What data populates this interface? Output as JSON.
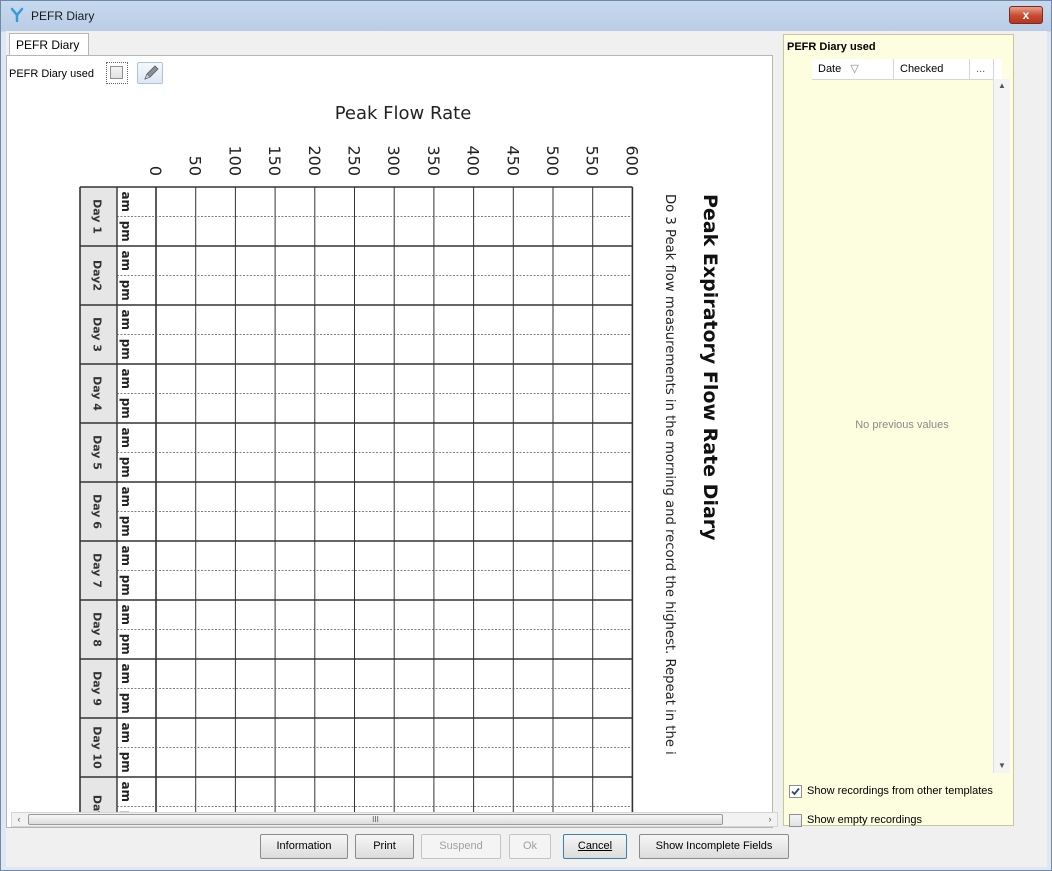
{
  "window": {
    "title": "PEFR Diary",
    "close_label": "x"
  },
  "tabs": [
    {
      "label": "PEFR Diary"
    }
  ],
  "form": {
    "used_label": "PEFR Diary used",
    "used_checked": false
  },
  "diary": {
    "title": "Peak Expiratory Flow Rate Diary",
    "instructions": "Do 3 Peak flow measurements in the morning and record the highest. Repeat in the i",
    "axis_title": "Peak Flow Rate",
    "ticks": [
      "0",
      "50",
      "100",
      "150",
      "200",
      "250",
      "300",
      "350",
      "400",
      "450",
      "500",
      "550",
      "600"
    ],
    "days": [
      "Day 1",
      "Day2",
      "Day 3",
      "Day 4",
      "Day 5",
      "Day 6",
      "Day 7",
      "Day 8",
      "Day 9",
      "Day 10",
      "Day"
    ],
    "periods": [
      "am",
      "pm"
    ]
  },
  "scrollbar": {
    "left_arrow": "‹",
    "right_arrow": "›",
    "thumb_grip": "III"
  },
  "right_panel": {
    "title": "PEFR Diary used",
    "columns": [
      {
        "label": "Date",
        "sort_icon": "▽"
      },
      {
        "label": "Checked"
      },
      {
        "label": "..."
      }
    ],
    "empty_message": "No previous values",
    "scroll_up": "▲",
    "scroll_down": "▼",
    "show_other_templates": {
      "label": "Show recordings from other templates",
      "checked": true
    },
    "show_empty": {
      "label": "Show empty recordings",
      "checked": false
    }
  },
  "buttons": {
    "information": "Information",
    "print": "Print",
    "suspend": "Suspend",
    "ok": "Ok",
    "cancel": "Cancel",
    "show_incomplete": "Show Incomplete Fields"
  },
  "colors": {
    "right_panel_bg": "#fdfde0",
    "close_red": "#c74a31"
  }
}
